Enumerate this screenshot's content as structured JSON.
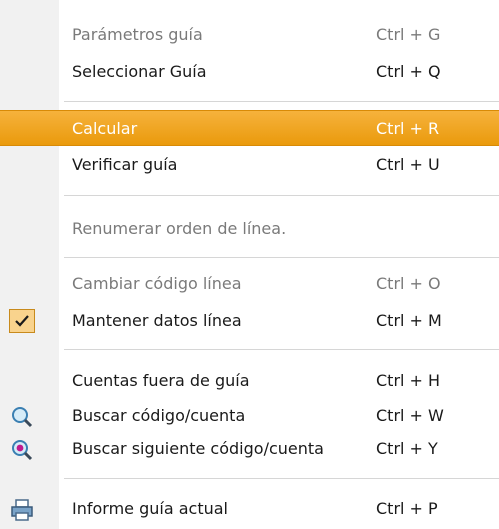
{
  "menu": {
    "items": [
      {
        "label": "Parámetros guía",
        "shortcut": "Ctrl + G"
      },
      {
        "label": "Seleccionar Guía",
        "shortcut": "Ctrl + Q"
      },
      {
        "label": "Calcular",
        "shortcut": "Ctrl + R"
      },
      {
        "label": "Verificar guía",
        "shortcut": "Ctrl + U"
      },
      {
        "label": "Renumerar orden de línea.",
        "shortcut": ""
      },
      {
        "label": "Cambiar código línea",
        "shortcut": "Ctrl + O"
      },
      {
        "label": "Mantener datos línea",
        "shortcut": "Ctrl + M"
      },
      {
        "label": "Cuentas fuera de guía",
        "shortcut": "Ctrl + H"
      },
      {
        "label": "Buscar código/cuenta",
        "shortcut": "Ctrl + W"
      },
      {
        "label": "Buscar siguiente código/cuenta",
        "shortcut": "Ctrl + Y"
      },
      {
        "label": "Informe guía actual",
        "shortcut": "Ctrl + P"
      }
    ],
    "highlight_color": "#f0a520",
    "icons": [
      "checkmark-icon",
      "magnifier-icon",
      "magnifier-next-icon",
      "printer-icon"
    ]
  }
}
